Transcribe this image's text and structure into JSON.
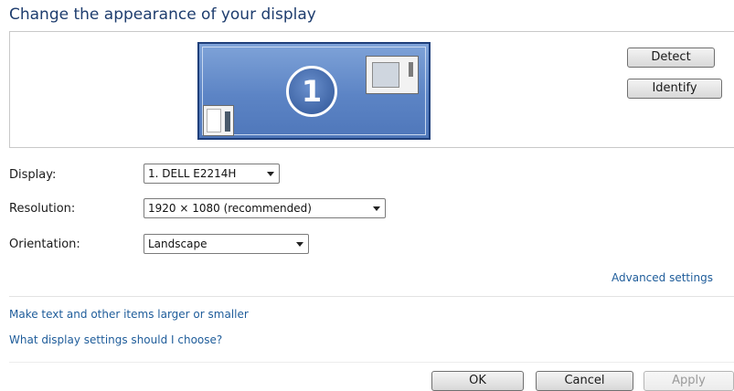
{
  "title": "Change the appearance of your display",
  "preview": {
    "monitor_number": "1"
  },
  "buttons": {
    "detect": "Detect",
    "identify": "Identify",
    "ok": "OK",
    "cancel": "Cancel",
    "apply": "Apply"
  },
  "fields": {
    "display": {
      "label": "Display:",
      "value": "1. DELL E2214H"
    },
    "resolution": {
      "label": "Resolution:",
      "value": "1920 × 1080 (recommended)"
    },
    "orientation": {
      "label": "Orientation:",
      "value": "Landscape"
    }
  },
  "links": {
    "advanced": "Advanced settings",
    "text_size": "Make text and other items larger or smaller",
    "which_settings": "What display settings should I choose?"
  },
  "icons": {
    "monitor": "monitor-icon",
    "window": "window-icon",
    "chevron": "chevron-down-icon"
  },
  "colors": {
    "title": "#1e3d6e",
    "link": "#1e5c9a",
    "monitor_fill": "#5c84c5",
    "monitor_border": "#1f3f7a"
  }
}
